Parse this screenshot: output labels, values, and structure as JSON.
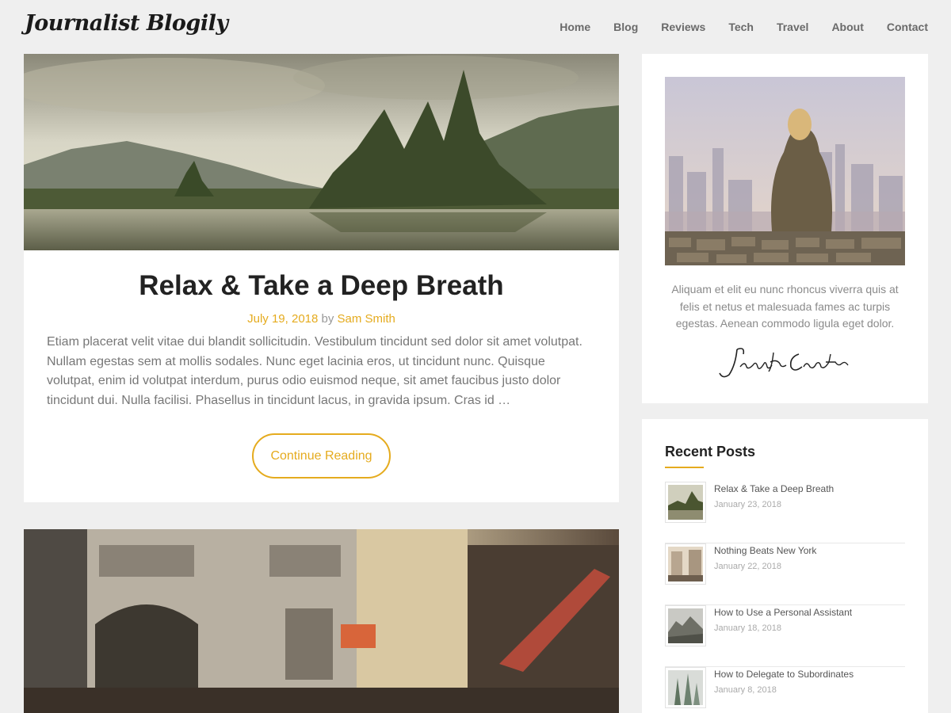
{
  "site": {
    "logo": "Journalist Blogily"
  },
  "nav": {
    "items": [
      "Home",
      "Blog",
      "Reviews",
      "Tech",
      "Travel",
      "About",
      "Contact"
    ]
  },
  "post": {
    "title": "Relax & Take a Deep Breath",
    "date": "July 19, 2018",
    "by": "by",
    "author": "Sam Smith",
    "excerpt": "Etiam placerat velit vitae dui blandit sollicitudin. Vestibulum tincidunt sed dolor sit amet volutpat. Nullam egestas sem at mollis sodales. Nunc eget lacinia eros, ut tincidunt nunc. Quisque volutpat, enim id volutpat interdum, purus odio euismod neque, sit amet faucibus justo dolor tincidunt dui. Nulla facilisi. Phasellus in tincidunt lacus, in gravida ipsum. Cras id …",
    "continue_label": "Continue Reading"
  },
  "about": {
    "text": "Aliquam et elit eu nunc rhoncus viverra quis at felis et netus et malesuada fames ac turpis egestas. Aenean commodo ligula eget dolor.",
    "signature": "Jenifer Carter"
  },
  "recent": {
    "title": "Recent Posts",
    "items": [
      {
        "title": "Relax & Take a Deep Breath",
        "date": "January 23, 2018"
      },
      {
        "title": "Nothing Beats New York",
        "date": "January 22, 2018"
      },
      {
        "title": "How to Use a Personal Assistant",
        "date": "January 18, 2018"
      },
      {
        "title": "How to Delegate to Subordinates",
        "date": "January 8, 2018"
      }
    ]
  },
  "colors": {
    "accent": "#e5ab1e",
    "background": "#efefef"
  }
}
